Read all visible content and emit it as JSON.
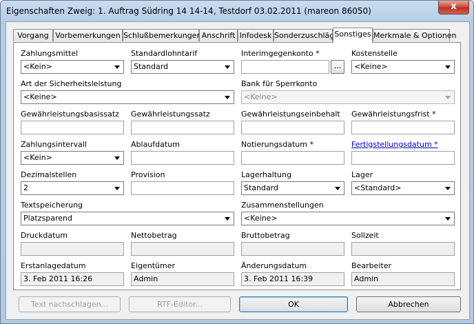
{
  "window": {
    "title": "Eigenschaften Zweig: 1. Auftrag Südring 14 14-14, Testdorf 03.02.2011 (mareon 86050)",
    "close_label": "x"
  },
  "tabs": [
    {
      "label": "Vorgang"
    },
    {
      "label": "Vorbemerkungen"
    },
    {
      "label": "Schlußbemerkungen"
    },
    {
      "label": "Anschrift"
    },
    {
      "label": "Infodesk"
    },
    {
      "label": "Sonderzuschläge"
    },
    {
      "label": "Sonstiges"
    },
    {
      "label": "Merkmale & Optionen"
    }
  ],
  "form": {
    "zahlungsmittel": {
      "label": "Zahlungsmittel",
      "value": "<Kein>"
    },
    "standardlohntarif": {
      "label": "Standardlohntarif",
      "value": "Standard"
    },
    "interimgegenkonto": {
      "label": "Interimgegenkonto *",
      "value": "",
      "browse": "..."
    },
    "kostenstelle": {
      "label": "Kostenstelle",
      "value": "<Keine>"
    },
    "sicherheitsleistung": {
      "label": "Art der Sicherheitsleistung",
      "value": "<Keine>"
    },
    "sperrkonto": {
      "label": "Bank für Sperrkonto",
      "value": "<Keine>"
    },
    "gewaehr_basissatz": {
      "label": "Gewährleistungsbasissatz",
      "value": ""
    },
    "gewaehr_satz": {
      "label": "Gewährleistungssatz",
      "value": ""
    },
    "gewaehr_einbehalt": {
      "label": "Gewährleistungseinbehalt",
      "value": ""
    },
    "gewaehr_frist": {
      "label": "Gewährleistungsfrist *",
      "value": ""
    },
    "zahlungsintervall": {
      "label": "Zahlungsintervall",
      "value": "<Kein>"
    },
    "ablaufdatum": {
      "label": "Ablaufdatum",
      "value": ""
    },
    "notierungsdatum": {
      "label": "Notierungsdatum *",
      "value": ""
    },
    "fertigstellungsdatum": {
      "label": "Fertigstellungsdatum *",
      "value": ""
    },
    "dezimalstellen": {
      "label": "Dezimalstellen",
      "value": "2"
    },
    "provision": {
      "label": "Provision",
      "value": ""
    },
    "lagerhaltung": {
      "label": "Lagerhaltung",
      "value": "Standard"
    },
    "lager": {
      "label": "Lager",
      "value": "<Standard>"
    },
    "textspeicherung": {
      "label": "Textspeicherung",
      "value": "Platzsparend"
    },
    "zusammenstellungen": {
      "label": "Zusammenstellungen",
      "value": "<Keine>"
    },
    "druckdatum": {
      "label": "Druckdatum",
      "value": ""
    },
    "nettobetrag": {
      "label": "Nettobetrag",
      "value": ""
    },
    "bruttobetrag": {
      "label": "Bruttobetrag",
      "value": ""
    },
    "sollzeit": {
      "label": "Sollzeit",
      "value": ""
    },
    "erstanlagedatum": {
      "label": "Erstanlagedatum",
      "value": "3. Feb 2011 16:26"
    },
    "eigentuemer": {
      "label": "Eigentümer",
      "value": "Admin"
    },
    "aenderungsdatum": {
      "label": "Änderungsdatum",
      "value": "3. Feb 2011 16:39"
    },
    "bearbeiter": {
      "label": "Bearbeiter",
      "value": "Admin"
    }
  },
  "buttons": {
    "text_nachschlagen": "Text nachschlagen...",
    "rtf_editor": "RTF-Editor...",
    "ok": "OK",
    "abbrechen": "Abbrechen"
  }
}
